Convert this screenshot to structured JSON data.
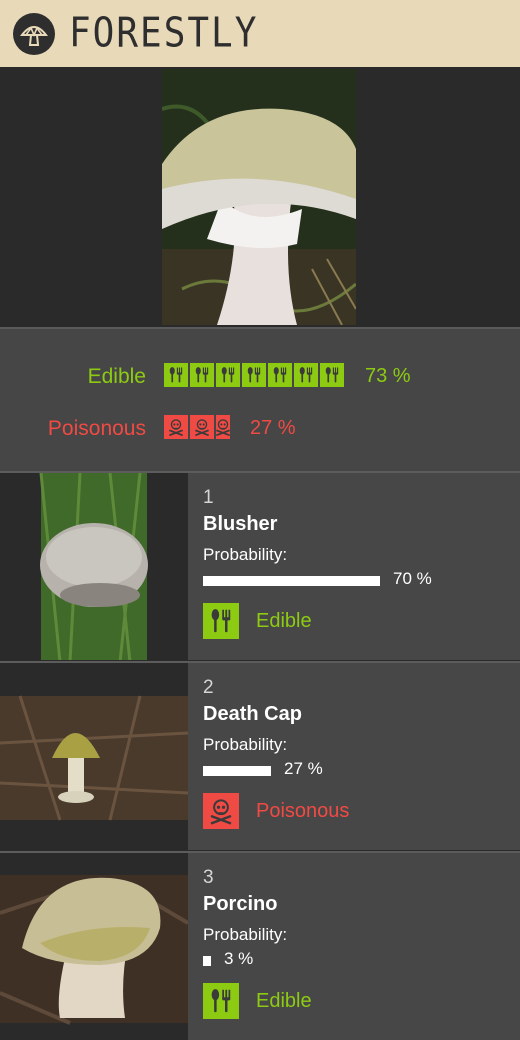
{
  "app": {
    "title": "FORESTLY",
    "colors": {
      "header_bg": "#e8d9b9",
      "edible": "#8dcb12",
      "poisonous": "#f04a44"
    }
  },
  "summary": {
    "edible": {
      "label": "Edible",
      "percent_text": "73 %",
      "percent": 73,
      "icon": "fork-spoon-icon"
    },
    "poisonous": {
      "label": "Poisonous",
      "percent_text": "27 %",
      "percent": 27,
      "icon": "skull-crossbones-icon"
    }
  },
  "results": [
    {
      "rank": "1",
      "name": "Blusher",
      "probability_label": "Probability:",
      "probability_text": "70 %",
      "probability": 0.7,
      "category": "Edible",
      "category_icon": "fork-spoon-icon"
    },
    {
      "rank": "2",
      "name": "Death Cap",
      "probability_label": "Probability:",
      "probability_text": "27 %",
      "probability": 0.27,
      "category": "Poisonous",
      "category_icon": "skull-crossbones-icon"
    },
    {
      "rank": "3",
      "name": "Porcino",
      "probability_label": "Probability:",
      "probability_text": "3 %",
      "probability": 0.03,
      "category": "Edible",
      "category_icon": "fork-spoon-icon"
    }
  ]
}
